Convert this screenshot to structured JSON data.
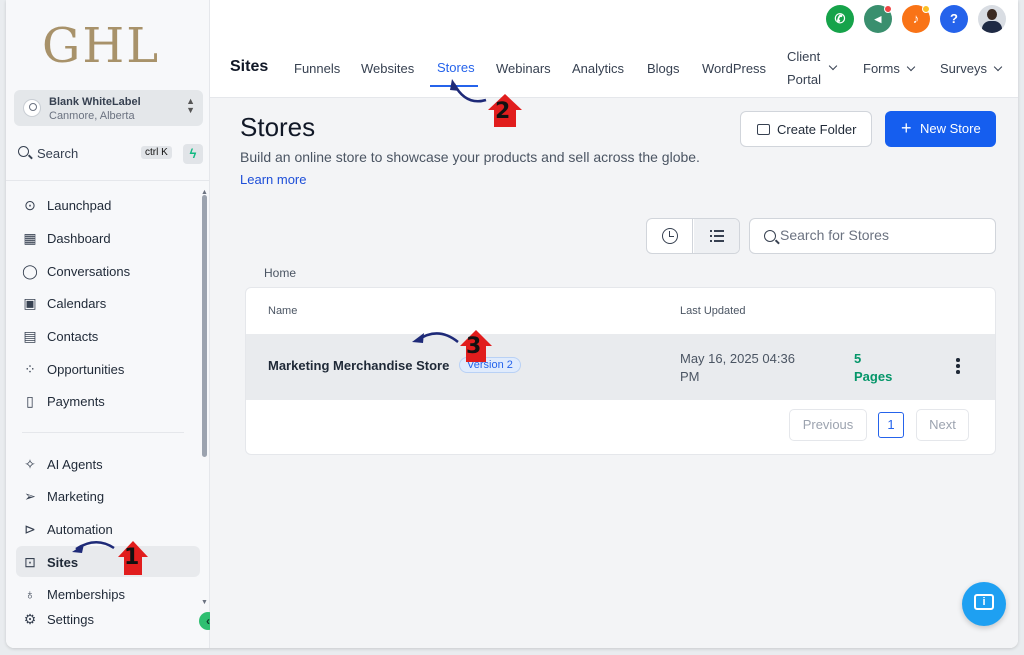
{
  "sidebar": {
    "logo": "GHL",
    "account": {
      "name": "Blank WhiteLabel",
      "location": "Canmore, Alberta"
    },
    "search": {
      "label": "Search",
      "shortcut": "ctrl K"
    },
    "items": [
      {
        "label": "Launchpad",
        "icon": "rocket-icon"
      },
      {
        "label": "Dashboard",
        "icon": "grid-icon"
      },
      {
        "label": "Conversations",
        "icon": "chat-icon"
      },
      {
        "label": "Calendars",
        "icon": "calendar-icon"
      },
      {
        "label": "Contacts",
        "icon": "contacts-icon"
      },
      {
        "label": "Opportunities",
        "icon": "pipeline-icon"
      },
      {
        "label": "Payments",
        "icon": "invoice-icon"
      },
      {
        "label": "AI Agents",
        "icon": "sparkle-icon"
      },
      {
        "label": "Marketing",
        "icon": "send-icon"
      },
      {
        "label": "Automation",
        "icon": "automation-icon"
      },
      {
        "label": "Sites",
        "icon": "sites-icon"
      },
      {
        "label": "Memberships",
        "icon": "award-icon"
      },
      {
        "label": "Settings",
        "icon": "gear-icon"
      }
    ]
  },
  "header": {
    "title": "Sites",
    "tabs": [
      {
        "label": "Funnels"
      },
      {
        "label": "Websites"
      },
      {
        "label": "Stores"
      },
      {
        "label": "Webinars"
      },
      {
        "label": "Analytics"
      },
      {
        "label": "Blogs"
      },
      {
        "label": "WordPress"
      },
      {
        "label": "Client",
        "label2": "Portal"
      },
      {
        "label": "Forms"
      },
      {
        "label": "Surveys"
      }
    ],
    "active_tab": "Stores",
    "icon_colors": {
      "phone": "#16a34a",
      "announce": "#3a8f6e",
      "bell": "#f97316",
      "help": "#2563eb"
    }
  },
  "main": {
    "title": "Stores",
    "description": "Build an online store to showcase your products and sell across the globe.",
    "learn_more": "Learn more",
    "create_folder": "Create Folder",
    "new_store": "New Store",
    "search_placeholder": "Search for Stores",
    "breadcrumb": "Home",
    "table": {
      "columns": [
        "Name",
        "Last Updated"
      ],
      "rows": [
        {
          "name": "Marketing Merchandise Store",
          "badge": "Version 2",
          "updated_line1": "May 16, 2025 04:36",
          "updated_line2": "PM",
          "pages_line1": "5",
          "pages_line2": "Pages"
        }
      ]
    },
    "pagination": {
      "previous": "Previous",
      "page": "1",
      "next": "Next"
    }
  },
  "annotations": [
    "1",
    "2",
    "3"
  ],
  "colors": {
    "primary": "#155eef",
    "accent_green": "#059669",
    "annotation_arrow": "#1e2a78",
    "annotation_marker": "#e11d1d"
  }
}
